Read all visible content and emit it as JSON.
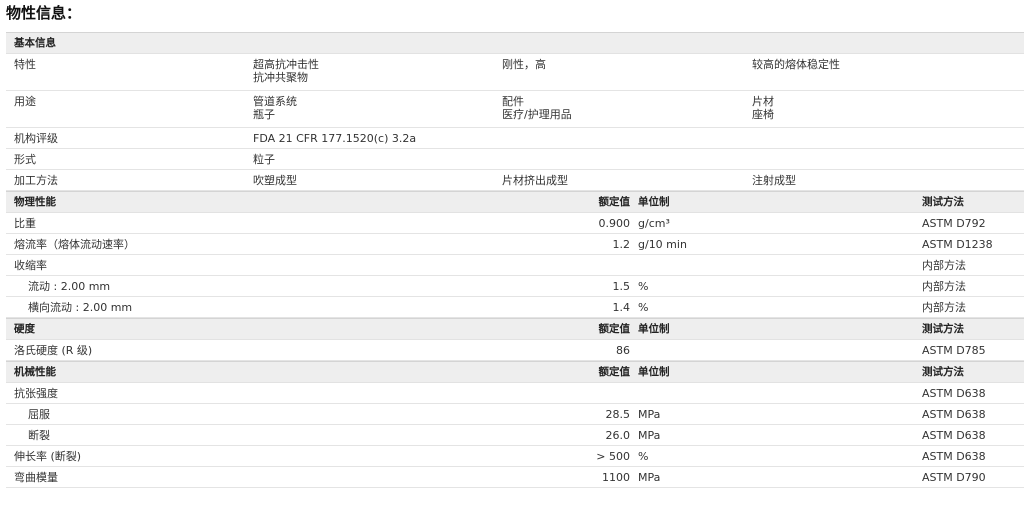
{
  "page_title": "物性信息：",
  "basic": {
    "header": "基本信息",
    "rows": [
      {
        "label": "特性",
        "cols": [
          [
            "超高抗冲击性",
            "抗冲共聚物"
          ],
          [
            "刚性，高"
          ],
          [
            "较高的熔体稳定性"
          ]
        ]
      },
      {
        "label": "用途",
        "cols": [
          [
            "管道系统",
            "瓶子"
          ],
          [
            "配件",
            "医疗/护理用品"
          ],
          [
            "片材",
            "座椅"
          ]
        ]
      },
      {
        "label": "机构评级",
        "cols": [
          [
            "FDA 21 CFR 177.1520(c) 3.2a"
          ]
        ]
      },
      {
        "label": "形式",
        "cols": [
          [
            "粒子"
          ]
        ]
      },
      {
        "label": "加工方法",
        "cols": [
          [
            "吹塑成型"
          ],
          [
            "片材挤出成型"
          ],
          [
            "注射成型"
          ]
        ]
      }
    ]
  },
  "physical": {
    "header": "物理性能",
    "col_value": "额定值",
    "col_unit": "单位制",
    "col_test": "测试方法",
    "rows": [
      {
        "label": "比重",
        "value": "0.900",
        "unit": "g/cm³",
        "test": "ASTM D792"
      },
      {
        "label": "熔流率（熔体流动速率）",
        "value": "1.2",
        "unit": "g/10 min",
        "test": "ASTM D1238"
      },
      {
        "label": "收缩率",
        "value": "",
        "unit": "",
        "test": "内部方法"
      },
      {
        "label": "流动 : 2.00 mm",
        "value": "1.5",
        "unit": "%",
        "test": "内部方法"
      },
      {
        "label": "横向流动 : 2.00 mm",
        "value": "1.4",
        "unit": "%",
        "test": "内部方法"
      }
    ]
  },
  "hardness": {
    "header": "硬度",
    "col_value": "额定值",
    "col_unit": "单位制",
    "col_test": "测试方法",
    "rows": [
      {
        "label": "洛氏硬度 (R 级)",
        "value": "86",
        "unit": "",
        "test": "ASTM D785"
      }
    ]
  },
  "mechanical": {
    "header": "机械性能",
    "col_value": "额定值",
    "col_unit": "单位制",
    "col_test": "测试方法",
    "rows": [
      {
        "label": "抗张强度",
        "value": "",
        "unit": "",
        "test": "ASTM D638"
      },
      {
        "label": "屈服",
        "value": "28.5",
        "unit": "MPa",
        "test": "ASTM D638"
      },
      {
        "label": "断裂",
        "value": "26.0",
        "unit": "MPa",
        "test": "ASTM D638"
      },
      {
        "label": "伸长率 (断裂)",
        "value": "> 500",
        "unit": "%",
        "test": "ASTM D638"
      },
      {
        "label": "弯曲模量",
        "value": "1100",
        "unit": "MPa",
        "test": "ASTM D790"
      }
    ]
  }
}
